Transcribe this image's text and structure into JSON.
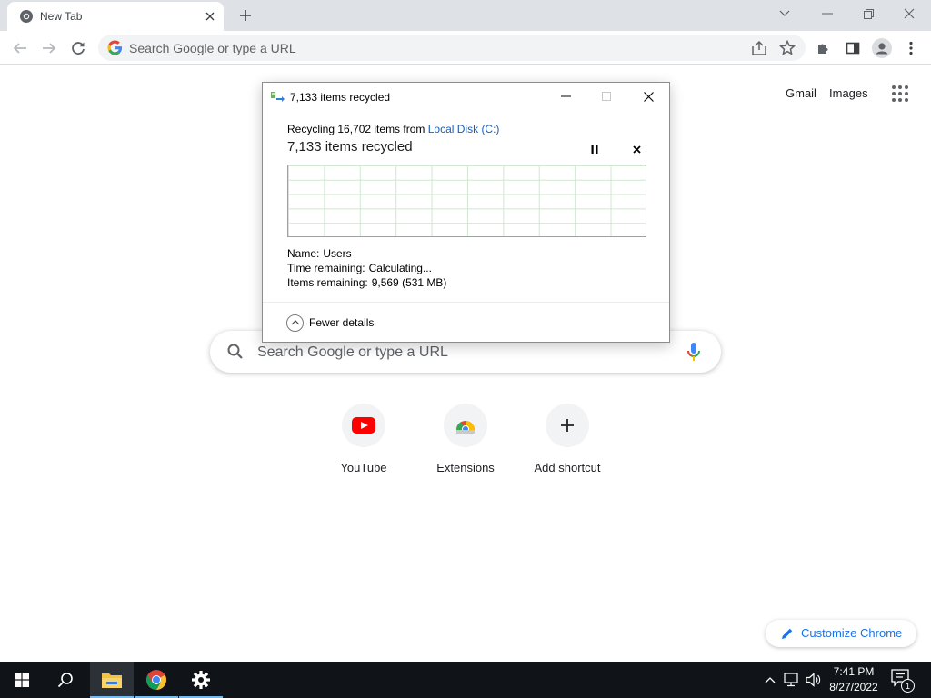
{
  "browser": {
    "tab": {
      "title": "New Tab"
    },
    "omnibox": {
      "placeholder": "Search Google or type a URL"
    }
  },
  "ntp": {
    "links": {
      "gmail": "Gmail",
      "images": "Images"
    },
    "search_placeholder": "Search Google or type a URL",
    "shortcuts": [
      {
        "label": "YouTube",
        "icon": "youtube-icon"
      },
      {
        "label": "Extensions",
        "icon": "extensions-store-icon"
      },
      {
        "label": "Add shortcut",
        "icon": "plus-icon"
      }
    ],
    "customize_label": "Customize Chrome"
  },
  "dialog": {
    "title": "7,133 items recycled",
    "line1_prefix": "Recycling 16,702 items from",
    "line1_link": "Local Disk (C:)",
    "heading": "7,133 items recycled",
    "details": [
      {
        "key": "Name:",
        "value": "Users"
      },
      {
        "key": "Time remaining:",
        "value": "Calculating..."
      },
      {
        "key": "Items remaining:",
        "value": "9,569 (531 MB)"
      }
    ],
    "fewer_details": "Fewer details"
  },
  "taskbar": {
    "time": "7:41 PM",
    "date": "8/27/2022",
    "notification_count": "1"
  },
  "colors": {
    "link_blue": "#1a73e8",
    "youtube_red": "#ff0000",
    "taskbar": "#101418"
  }
}
